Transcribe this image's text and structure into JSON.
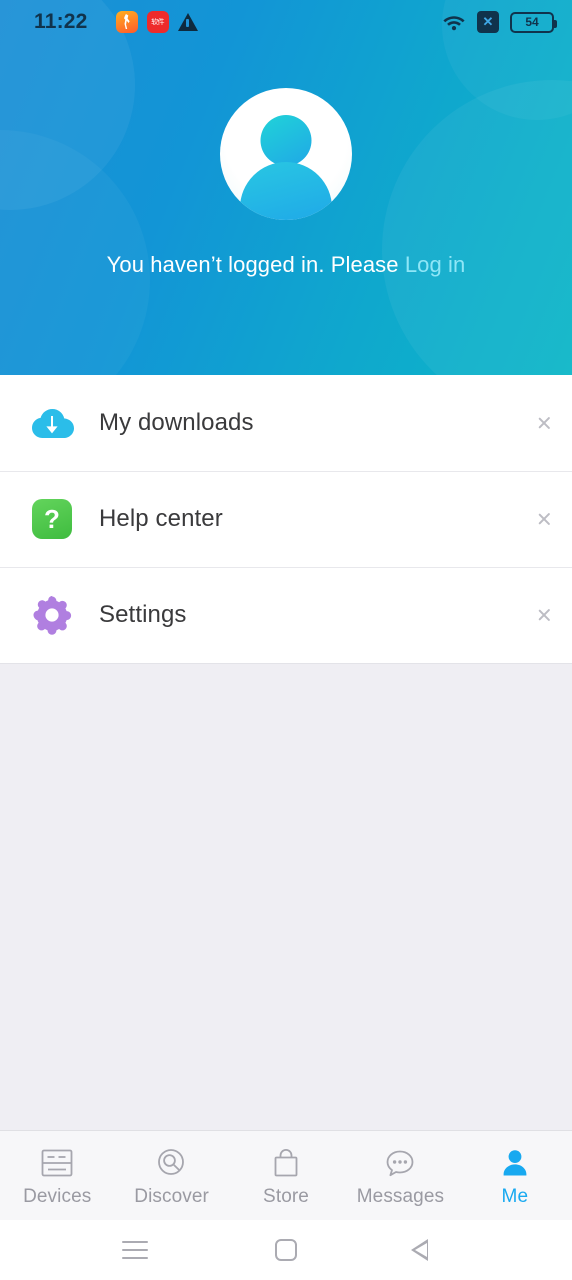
{
  "colors": {
    "header_gradient_start": "#1C8FD6",
    "header_gradient_end": "#0DB7C8",
    "accent": "#18A9F0",
    "login_link": "#8FE6F7",
    "page_background": "#EFEEF3",
    "list_background": "#FFFFFF",
    "label_text": "#3A3A3C",
    "tab_inactive": "#9A9AA2",
    "download_icon": "#29BCE8",
    "help_icon": "#4BC84B",
    "settings_icon": "#B07FE0"
  },
  "status_bar": {
    "time": "11:22",
    "left_icons": [
      {
        "name": "running-app-icon",
        "label": ""
      },
      {
        "name": "chinese-app-icon",
        "label": "软件"
      },
      {
        "name": "warning-triangle-icon",
        "label": ""
      }
    ],
    "right_icons": [
      {
        "name": "wifi-icon"
      },
      {
        "name": "no-signal-x-icon"
      }
    ],
    "battery_level": "54"
  },
  "header": {
    "avatar_name": "default-user-avatar",
    "login_prompt": "You haven’t logged in. Please",
    "login_link": "Log in"
  },
  "menu": {
    "items": [
      {
        "label": "My downloads",
        "icon": "cloud-download-icon"
      },
      {
        "label": "Help center",
        "icon": "question-mark-icon"
      },
      {
        "label": "Settings",
        "icon": "gear-icon"
      }
    ]
  },
  "tabbar": {
    "tabs": [
      {
        "label": "Devices",
        "icon": "device-panel-icon",
        "active": false
      },
      {
        "label": "Discover",
        "icon": "magnifier-icon",
        "active": false
      },
      {
        "label": "Store",
        "icon": "shopping-bag-icon",
        "active": false
      },
      {
        "label": "Messages",
        "icon": "chat-bubble-icon",
        "active": false
      },
      {
        "label": "Me",
        "icon": "person-icon",
        "active": true
      }
    ]
  },
  "navbar": {
    "buttons": [
      {
        "name": "recents-button"
      },
      {
        "name": "home-button"
      },
      {
        "name": "back-button"
      }
    ]
  }
}
